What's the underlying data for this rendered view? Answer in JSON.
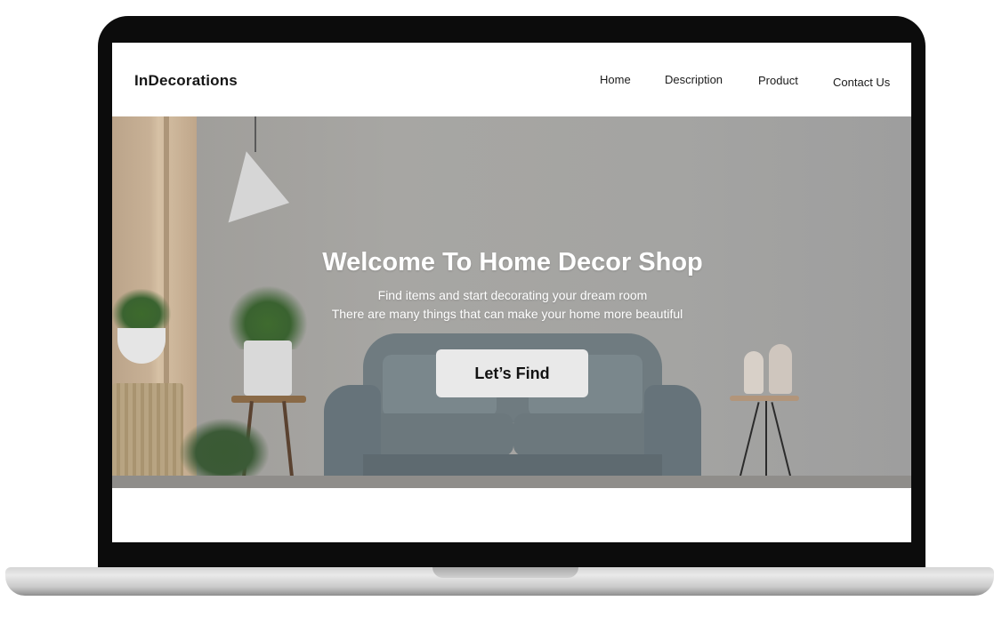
{
  "navbar": {
    "brand": "InDecorations",
    "links": [
      {
        "label": "Home"
      },
      {
        "label": "Description"
      },
      {
        "label": "Product"
      },
      {
        "label": "Contact Us"
      }
    ]
  },
  "hero": {
    "title": "Welcome To Home Decor Shop",
    "subtitle_line1": "Find items and start decorating your dream room",
    "subtitle_line2": "There are many things that can make your home more beautiful",
    "cta_label": "Let’s Find"
  },
  "colors": {
    "bezel": "#0c0c0c",
    "navbar_bg": "#ffffff",
    "hero_overlay": "#a5a4a1",
    "cta_bg": "#e9e9e9",
    "text_dark": "#161616"
  }
}
